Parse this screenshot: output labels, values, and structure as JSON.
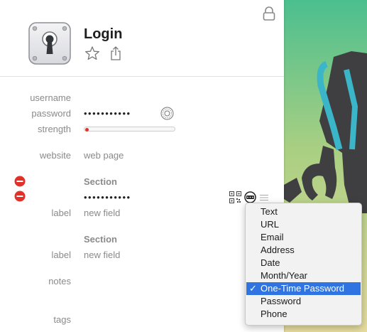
{
  "item": {
    "title": "Login"
  },
  "fields": {
    "username_label": "username",
    "password_label": "password",
    "password_value": "•••••••••••",
    "strength_label": "strength",
    "strength_level": 0.03,
    "website_label": "website",
    "website_value": "web page"
  },
  "section1": {
    "title": "Section",
    "otp_value": "•••••••••••",
    "label": "label",
    "new_field": "new field"
  },
  "section2": {
    "title": "Section",
    "label": "label",
    "new_field": "new field"
  },
  "notes_label": "notes",
  "tags_label": "tags",
  "field_type_menu": {
    "items": [
      "Text",
      "URL",
      "Email",
      "Address",
      "Date",
      "Month/Year",
      "One-Time Password",
      "Password",
      "Phone"
    ],
    "selected": "One-Time Password",
    "check": "✓"
  },
  "colors": {
    "accent": "#2f74e0",
    "strength_red": "#e0312b",
    "delete_red": "#e0312b",
    "robot_teal": "#3ab6c8"
  },
  "icons": {
    "lock": "lock-icon",
    "item": "keyhole-icon",
    "favorite": "star-icon",
    "share": "share-icon",
    "generator": "password-generator-icon",
    "qr": "qr-code-icon",
    "otp": "otp-icon",
    "drag": "drag-handle-icon",
    "delete": "delete-field-icon"
  }
}
